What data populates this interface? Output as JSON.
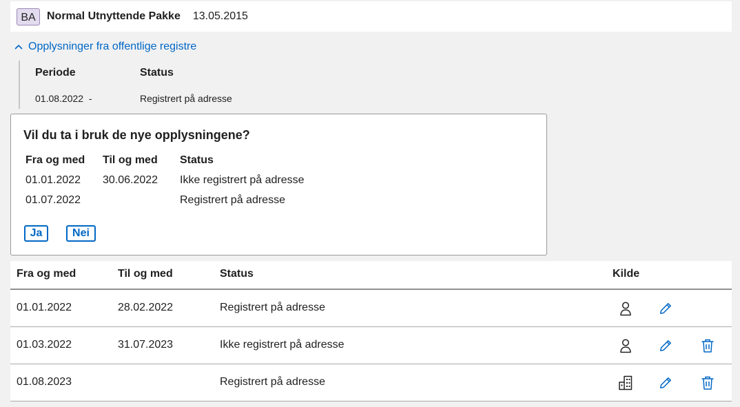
{
  "header": {
    "badge": "BA",
    "title": "Normal Utnyttende Pakke",
    "date": "13.05.2015"
  },
  "registry": {
    "toggle_label": "Opplysninger fra offentlige registre",
    "columns": [
      "Periode",
      "Status"
    ],
    "row": {
      "period": "01.08.2022  -",
      "status": "Registrert på adresse"
    }
  },
  "dialog": {
    "title": "Vil du ta i bruk de nye opplysningene?",
    "columns": [
      "Fra og med",
      "Til og med",
      "Status"
    ],
    "rows": [
      {
        "from": "01.01.2022",
        "to": "30.06.2022",
        "status": "Ikke registrert på adresse"
      },
      {
        "from": "01.07.2022",
        "to": "",
        "status": "Registrert på adresse"
      }
    ],
    "yes_label": "Ja",
    "no_label": "Nei"
  },
  "table": {
    "columns": [
      "Fra og med",
      "Til og med",
      "Status",
      "Kilde"
    ],
    "rows": [
      {
        "from": "01.01.2022",
        "to": "28.02.2022",
        "status": "Registrert på adresse",
        "source_icon": "person-icon",
        "deletable": false
      },
      {
        "from": "01.03.2022",
        "to": "31.07.2023",
        "status": "Ikke registrert på adresse",
        "source_icon": "person-icon",
        "deletable": true
      },
      {
        "from": "01.08.2023",
        "to": "",
        "status": "Registrert på adresse",
        "source_icon": "building-icon",
        "deletable": true
      }
    ]
  },
  "icons": {
    "toggle": "chevron-up-icon",
    "edit": "pencil-icon",
    "delete": "trash-icon"
  },
  "colors": {
    "accent": "#0067c5",
    "badge_bg": "#e3dbee",
    "page_bg": "#f1f1f2"
  }
}
